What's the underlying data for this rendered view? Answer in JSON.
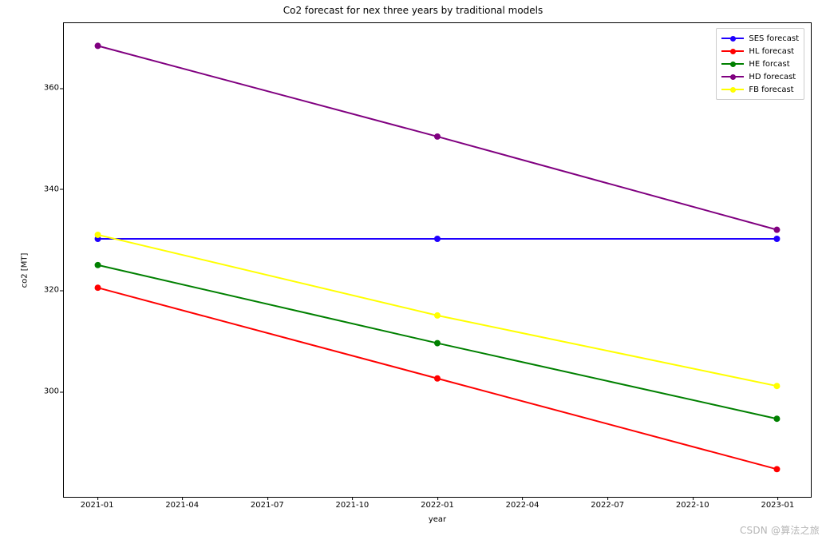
{
  "chart_data": {
    "type": "line",
    "title": "Co2 forecast for nex three years by traditional models",
    "xlabel": "year",
    "ylabel": "co2 [MT]",
    "x_ticks": [
      "2021-01",
      "2021-04",
      "2021-07",
      "2021-10",
      "2022-01",
      "2022-04",
      "2022-07",
      "2022-10",
      "2023-01"
    ],
    "y_ticks": [
      300,
      320,
      340,
      360
    ],
    "x": [
      0,
      12,
      24
    ],
    "x_categories": [
      "2021-01",
      "2022-01",
      "2023-01"
    ],
    "ylim": [
      279,
      373
    ],
    "xlim": [
      -1.2,
      25.2
    ],
    "series": [
      {
        "name": "SES forecast",
        "color": "#1f00ff",
        "values": [
          330.2,
          330.2,
          330.2
        ]
      },
      {
        "name": "HL forecast",
        "color": "#ff0000",
        "values": [
          320.5,
          302.5,
          284.5
        ]
      },
      {
        "name": "HE forcast",
        "color": "#008000",
        "values": [
          325.0,
          309.5,
          294.5
        ]
      },
      {
        "name": "HD forecast",
        "color": "#800080",
        "values": [
          368.5,
          350.5,
          332.0
        ]
      },
      {
        "name": "FB forecast",
        "color": "#ffff00",
        "values": [
          331.0,
          315.0,
          301.0
        ]
      }
    ]
  },
  "watermark": "CSDN @算法之旅"
}
